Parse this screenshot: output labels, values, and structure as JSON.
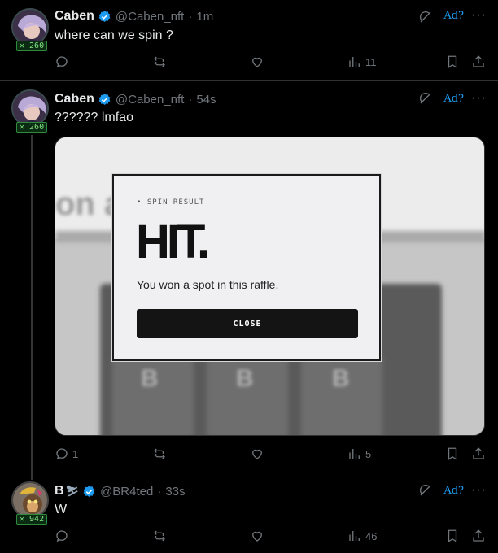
{
  "tweets": [
    {
      "name": "Caben",
      "handle": "@Caben_nft",
      "time": "1m",
      "text": "where can we spin ?",
      "badge": "✕ 260",
      "ad": "Ad?",
      "more": "···",
      "actions": {
        "replies": "",
        "reposts": "",
        "likes": "",
        "views": "11"
      }
    },
    {
      "name": "Caben",
      "handle": "@Caben_nft",
      "time": "54s",
      "text": "?????? lmfao",
      "badge": "✕ 260",
      "ad": "Ad?",
      "more": "···",
      "actions": {
        "replies": "1",
        "reposts": "",
        "likes": "",
        "views": "5"
      },
      "media": {
        "modal_kicker": "• SPIN RESULT",
        "modal_title": "HIT.",
        "modal_message": "You won a spot in this raffle.",
        "modal_button": "CLOSE",
        "bg_text": "on a",
        "cell_glyph": "B"
      }
    },
    {
      "name": "B",
      "name_suffix": "⛷",
      "handle": "@BR4ted",
      "time": "33s",
      "text": "W",
      "badge": "✕ 942",
      "ad": "Ad?",
      "more": "···",
      "actions": {
        "replies": "",
        "reposts": "",
        "likes": "",
        "views": "46"
      }
    }
  ],
  "colors": {
    "accent": "#1d9bf0",
    "muted": "#71767b",
    "badge_green": "#7ee081"
  }
}
